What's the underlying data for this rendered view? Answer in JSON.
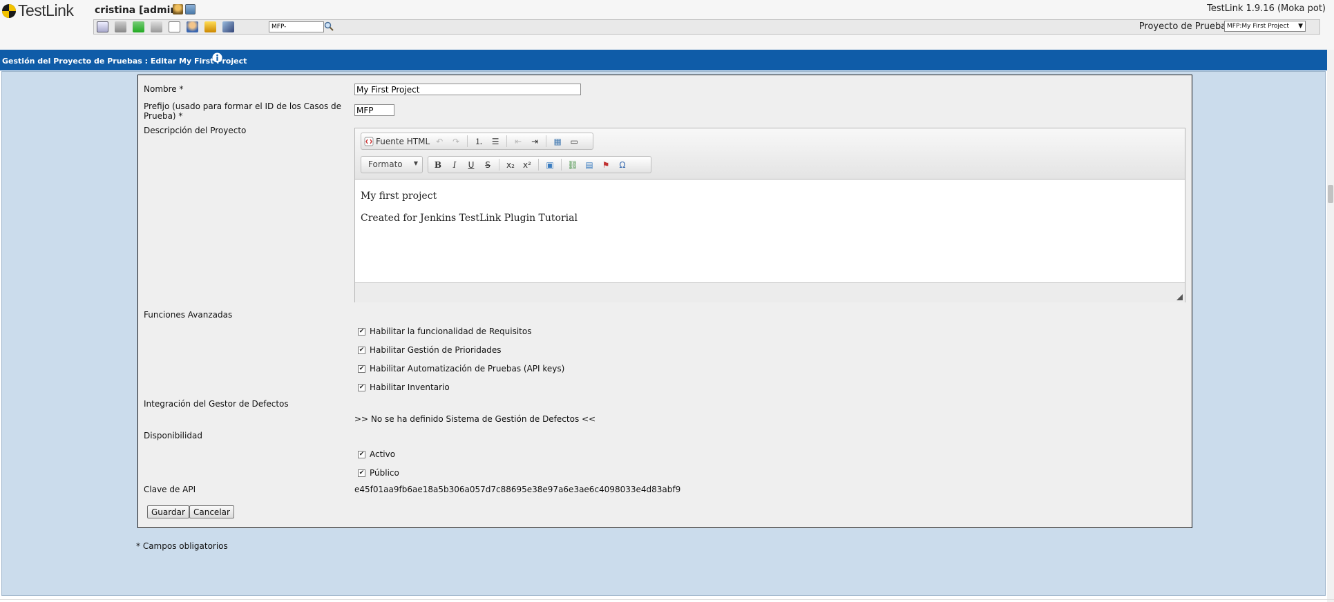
{
  "header": {
    "app_name": "TestLink",
    "user": "cristina [admin]",
    "version": "TestLink 1.9.16 (Moka pot)",
    "testcase_search_value": "MFP-",
    "project_label": "Proyecto de Pruebas",
    "project_selected": "MFP:My First Project",
    "nav_icons": [
      "desktop-icon",
      "cart-icon",
      "tree-icon",
      "tag-icon",
      "document-icon",
      "users-icon",
      "broom-icon",
      "rocket-icon"
    ]
  },
  "titlebar": {
    "title": "Gestión del Proyecto de Pruebas : Editar My First Project"
  },
  "form": {
    "name_label": "Nombre *",
    "name_value": "My First Project",
    "prefix_label_line1": "Prefijo (usado para formar el ID de los Casos de",
    "prefix_label_line2": "Prueba) *",
    "prefix_value": "MFP",
    "description_label": "Descripción del Proyecto",
    "editor": {
      "source_button": "Fuente HTML",
      "format_combo": "Formato",
      "content": [
        "My first project",
        "Created for Jenkins TestLink Plugin Tutorial"
      ]
    },
    "advanced_label": "Funciones Avanzadas",
    "advanced_options": [
      {
        "label": "Habilitar la funcionalidad de Requisitos",
        "checked": true
      },
      {
        "label": "Habilitar Gestión de Prioridades",
        "checked": true
      },
      {
        "label": "Habilitar Automatización de Pruebas (API keys)",
        "checked": true
      },
      {
        "label": "Habilitar Inventario",
        "checked": true
      }
    ],
    "issue_tracker_label": "Integración del Gestor de Defectos",
    "issue_tracker_value": ">> No se ha definido Sistema de Gestión de Defectos <<",
    "availability_label": "Disponibilidad",
    "availability_options": [
      {
        "label": "Activo",
        "checked": true
      },
      {
        "label": "Público",
        "checked": true
      }
    ],
    "api_key_label": "Clave de API",
    "api_key_value": "e45f01aa9fb6ae18a5b306a057d7c88695e38e97a6e3ae6c4098033e4d83abf9",
    "save_button": "Guardar",
    "cancel_button": "Cancelar"
  },
  "footer_note": "* Campos obligatorios",
  "colors": {
    "titlebar": "#0f5ca8",
    "main_bg": "#cbdcec",
    "form_bg": "#efefef"
  }
}
